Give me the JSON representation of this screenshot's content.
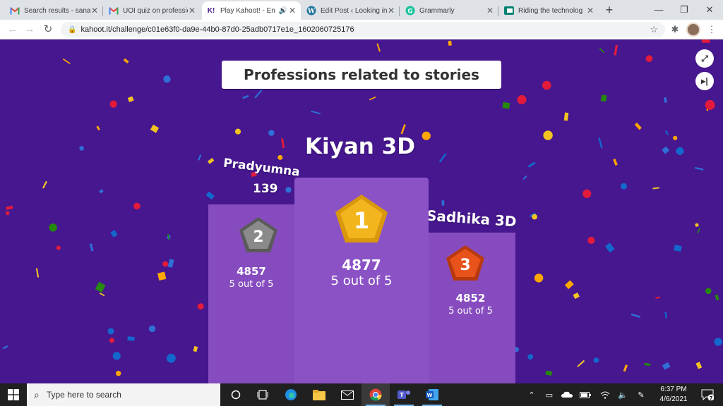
{
  "browser": {
    "tabs": [
      {
        "title": "Search results - sana",
        "icon": "gmail-icon"
      },
      {
        "title": "UOI quiz on professio",
        "icon": "gmail-icon"
      },
      {
        "title": "Play Kahoot! - En",
        "icon": "kahoot-icon",
        "active": true,
        "audio": true
      },
      {
        "title": "Edit Post ‹ Looking in",
        "icon": "wordpress-icon"
      },
      {
        "title": "Grammarly",
        "icon": "grammarly-icon"
      },
      {
        "title": "Riding the technolog",
        "icon": "sway-icon"
      }
    ],
    "url": "kahoot.it/challenge/c01e63f0-da9e-44b0-87d0-25adb0717e1e_1602060725176"
  },
  "game": {
    "quiz_title": "Professions related to stories",
    "podium": [
      {
        "rank": "1",
        "name": "Kiyan 3D",
        "score": "4877",
        "correct": "5 out of 5",
        "medal_color": "#f2b51d"
      },
      {
        "rank": "2",
        "name": "Pradyumna",
        "score": "4857",
        "correct": "5 out of 5",
        "medal_color": "#7a7a7a"
      },
      {
        "rank": "3",
        "name": "Sadhika 3D",
        "score": "4852",
        "correct": "5 out of 5",
        "medal_color": "#e8521b"
      }
    ],
    "floating_number": "139"
  },
  "taskbar": {
    "search_placeholder": "Type here to search",
    "time": "6:37 PM",
    "date": "4/6/2021",
    "notification_count": "7"
  },
  "colors": {
    "background": "#46178f",
    "podium": "#864cbf"
  }
}
